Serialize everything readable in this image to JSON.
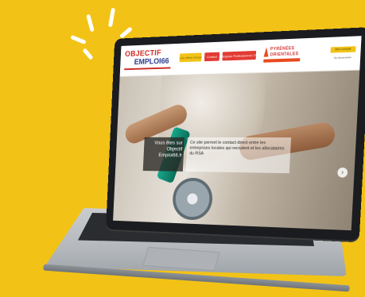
{
  "site": {
    "logo": {
      "line1": "OBJECTIF",
      "line2": "EMPLOI66"
    },
    "nav": [
      "Les offres d'emploi",
      "Contact",
      "Espace Professionnel / Particulier"
    ],
    "partner_logo": {
      "title": "PYRÉNÉES",
      "subtitle": "ORIENTALES"
    },
    "account": {
      "button": "Mon compte",
      "link": "Se déconnecter"
    }
  },
  "hero": {
    "left_text": "Vous êtes sur Objectif Emploi66.fr",
    "right_text": "Ce site permet le contact direct entre les entreprises locales qui recrutent et les allocataires du RSA",
    "next_arrow": "›"
  },
  "colors": {
    "background": "#f2c316",
    "brand_red": "#e23b33",
    "brand_blue": "#2c3a8c",
    "accent_yellow": "#f2c316"
  }
}
